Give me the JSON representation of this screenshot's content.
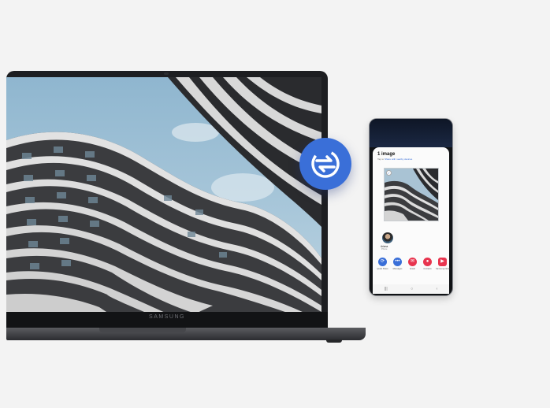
{
  "laptop": {
    "brand_label": "SAMSUNG"
  },
  "share_icon": {
    "name": "quick-share-icon",
    "color": "#3a6fd8"
  },
  "phone": {
    "share_sheet": {
      "title": "1 image",
      "subtitle_prefix": "Tap to ",
      "subtitle_link": "Share with nearby devices",
      "contact": {
        "name": "Ariana",
        "subtitle": "Phone"
      },
      "apps": [
        {
          "label": "Quick Share",
          "icon": "quick-share-icon",
          "color": "#3a6fd8"
        },
        {
          "label": "Messages",
          "icon": "messages-icon",
          "color": "#3a6fd8"
        },
        {
          "label": "Email",
          "icon": "email-icon",
          "color": "#e8344e"
        },
        {
          "label": "Contacts",
          "icon": "contacts-icon",
          "color": "#e8344e"
        },
        {
          "label": "Samsung Notes",
          "icon": "notes-icon",
          "color": "#e8344e"
        }
      ]
    },
    "nav": {
      "recent": "|||",
      "home": "○",
      "back": "‹"
    }
  }
}
